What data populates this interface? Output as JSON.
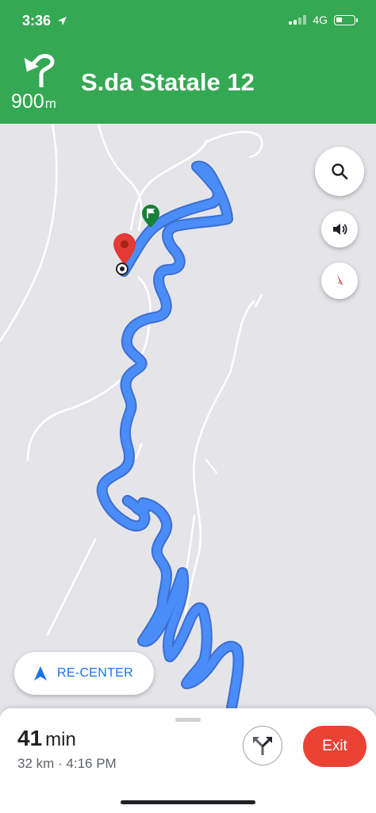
{
  "status_bar": {
    "time": "3:36",
    "network": "4G"
  },
  "navigation": {
    "distance_value": "900",
    "distance_unit": "m",
    "street": "S.da Statale 12",
    "turn_icon": "turn-sharp-left-icon"
  },
  "map_controls": {
    "search_icon": "search-icon",
    "sound_icon": "volume-icon",
    "compass_icon": "compass-icon"
  },
  "recenter": {
    "label": "RE-CENTER"
  },
  "trip": {
    "duration_value": "41",
    "duration_unit": "min",
    "details": "32 km · 4:16 PM",
    "exit_label": "Exit"
  },
  "colors": {
    "header": "#34a853",
    "route": "#4285f4",
    "exit": "#ea4335",
    "recenter_text": "#1a73e8",
    "map_bg": "#e5e5e9"
  }
}
